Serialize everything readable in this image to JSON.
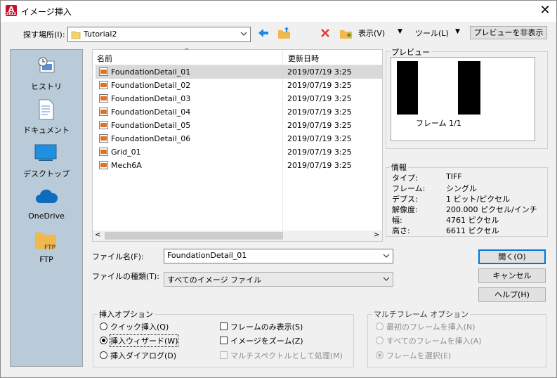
{
  "window": {
    "title": "イメージ挿入",
    "app_icon_letter": "A",
    "app_icon_sub": "2022"
  },
  "toolbar": {
    "look_in_label": "探す場所(I):",
    "look_in_value": "Tutorial2",
    "views_label": "表示(V)",
    "tools_label": "ツール(L)",
    "preview_toggle_label": "プレビューを非表示"
  },
  "places": [
    {
      "label": "ヒストリ",
      "icon": "history-icon"
    },
    {
      "label": "ドキュメント",
      "icon": "documents-icon"
    },
    {
      "label": "デスクトップ",
      "icon": "desktop-icon"
    },
    {
      "label": "OneDrive",
      "icon": "onedrive-icon"
    },
    {
      "label": "FTP",
      "icon": "ftp-icon"
    }
  ],
  "file_list": {
    "columns": {
      "name": "名前",
      "date": "更新日時"
    },
    "rows": [
      {
        "name": "FoundationDetail_01",
        "date": "2019/07/19 3:25",
        "selected": true
      },
      {
        "name": "FoundationDetail_02",
        "date": "2019/07/19 3:25"
      },
      {
        "name": "FoundationDetail_03",
        "date": "2019/07/19 3:25"
      },
      {
        "name": "FoundationDetail_04",
        "date": "2019/07/19 3:25"
      },
      {
        "name": "FoundationDetail_05",
        "date": "2019/07/19 3:25"
      },
      {
        "name": "FoundationDetail_06",
        "date": "2019/07/19 3:25"
      },
      {
        "name": "Grid_01",
        "date": "2019/07/19 3:25"
      },
      {
        "name": "Mech6A",
        "date": "2019/07/19 3:25"
      }
    ]
  },
  "preview": {
    "title": "プレビュー",
    "frame_text": "フレーム 1/1"
  },
  "info": {
    "title": "情報",
    "rows": [
      {
        "key": "タイプ:",
        "value": "TIFF"
      },
      {
        "key": "フレーム:",
        "value": "シングル"
      },
      {
        "key": "デプス:",
        "value": "1 ビット/ピクセル"
      },
      {
        "key": "解像度:",
        "value": "200.000 ピクセル/インチ"
      },
      {
        "key": "幅:",
        "value": "4761 ピクセル"
      },
      {
        "key": "高さ:",
        "value": "6611 ピクセル"
      }
    ]
  },
  "filename": {
    "label": "ファイル名(F):",
    "value": "FoundationDetail_01"
  },
  "filetype": {
    "label": "ファイルの種類(T):",
    "value": "すべてのイメージ ファイル"
  },
  "buttons": {
    "open": "開く(O)",
    "cancel": "キャンセル",
    "help": "ヘルプ(H)"
  },
  "insert_options": {
    "title": "挿入オプション",
    "quick_insert": "クイック挿入(Q)",
    "insert_wizard": "挿入ウィザード(W)",
    "insert_dialog": "挿入ダイアログ(D)",
    "frames_only": "フレームのみ表示(S)",
    "zoom_image": "イメージをズーム(Z)",
    "multispectral": "マルチスペクトルとして処理(M)"
  },
  "multiframe_options": {
    "title": "マルチフレーム オプション",
    "insert_first": "最初のフレームを挿入(N)",
    "insert_all": "すべてのフレームを挿入(A)",
    "select_frame": "フレームを選択(E)"
  }
}
